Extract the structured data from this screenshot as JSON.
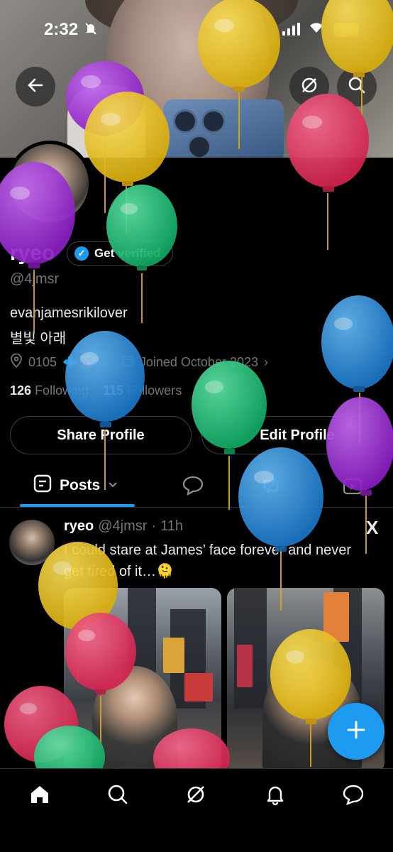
{
  "status_bar": {
    "time": "2:32",
    "battery": "68"
  },
  "profile": {
    "name": "ryeo",
    "verify_label": "Get verified",
    "handle": "@4jmsr",
    "bio_line1": "evanjamesrikilover",
    "bio_line2": "별빛 아래",
    "location": "0105",
    "location_emoji": "💠🍒",
    "joined": "Joined October 2023",
    "following_count": "126",
    "following_label": "Following",
    "followers_count": "115",
    "followers_label": "Followers",
    "share_label": "Share Profile",
    "edit_label": "Edit Profile"
  },
  "tabs": {
    "posts_label": "Posts"
  },
  "post": {
    "name": "ryeo",
    "handle": "@4jmsr",
    "dot": "·",
    "time": "11h",
    "text": "I could stare at James’ face forever and never get tired of it…🫠",
    "x_label": "X"
  },
  "icons": {
    "back": "arrow-left-icon",
    "grok": "grok-icon",
    "search": "search-icon",
    "location": "location-pin-icon",
    "calendar": "calendar-icon",
    "compose": "plus-icon",
    "nav": [
      "home-icon",
      "search-icon",
      "grok-icon",
      "bell-icon",
      "message-icon"
    ]
  },
  "colors": {
    "accent": "#1d9bf0",
    "balloon_purple": "#9b2fd0",
    "balloon_yellow": "#e8c21a",
    "balloon_pink": "#e63360",
    "balloon_green": "#1fc47a",
    "balloon_blue": "#2b8fde"
  }
}
